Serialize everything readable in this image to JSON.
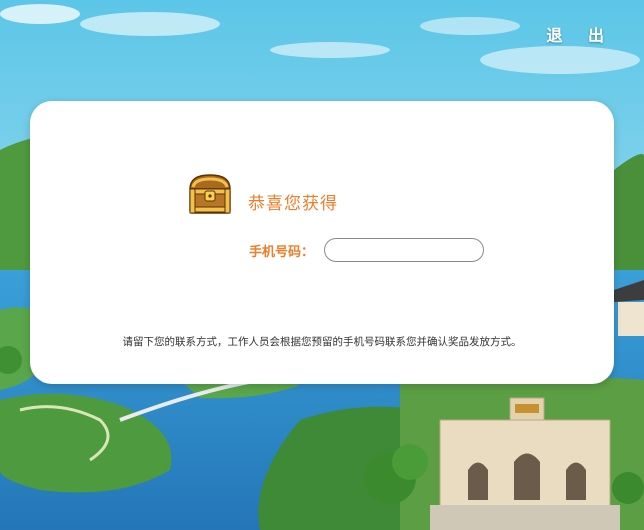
{
  "header": {
    "exit_label": "退 出"
  },
  "modal": {
    "title": "恭喜您获得",
    "phone_label": "手机号码：",
    "phone_value": "",
    "phone_placeholder": "",
    "note": "请留下您的联系方式，工作人员会根据您预留的手机号码联系您并确认奖品发放方式。"
  },
  "icons": {
    "prize": "treasure-chest-icon"
  },
  "colors": {
    "accent": "#ef7d2a",
    "water": "#2f8fd0",
    "grass": "#5aa64a"
  }
}
